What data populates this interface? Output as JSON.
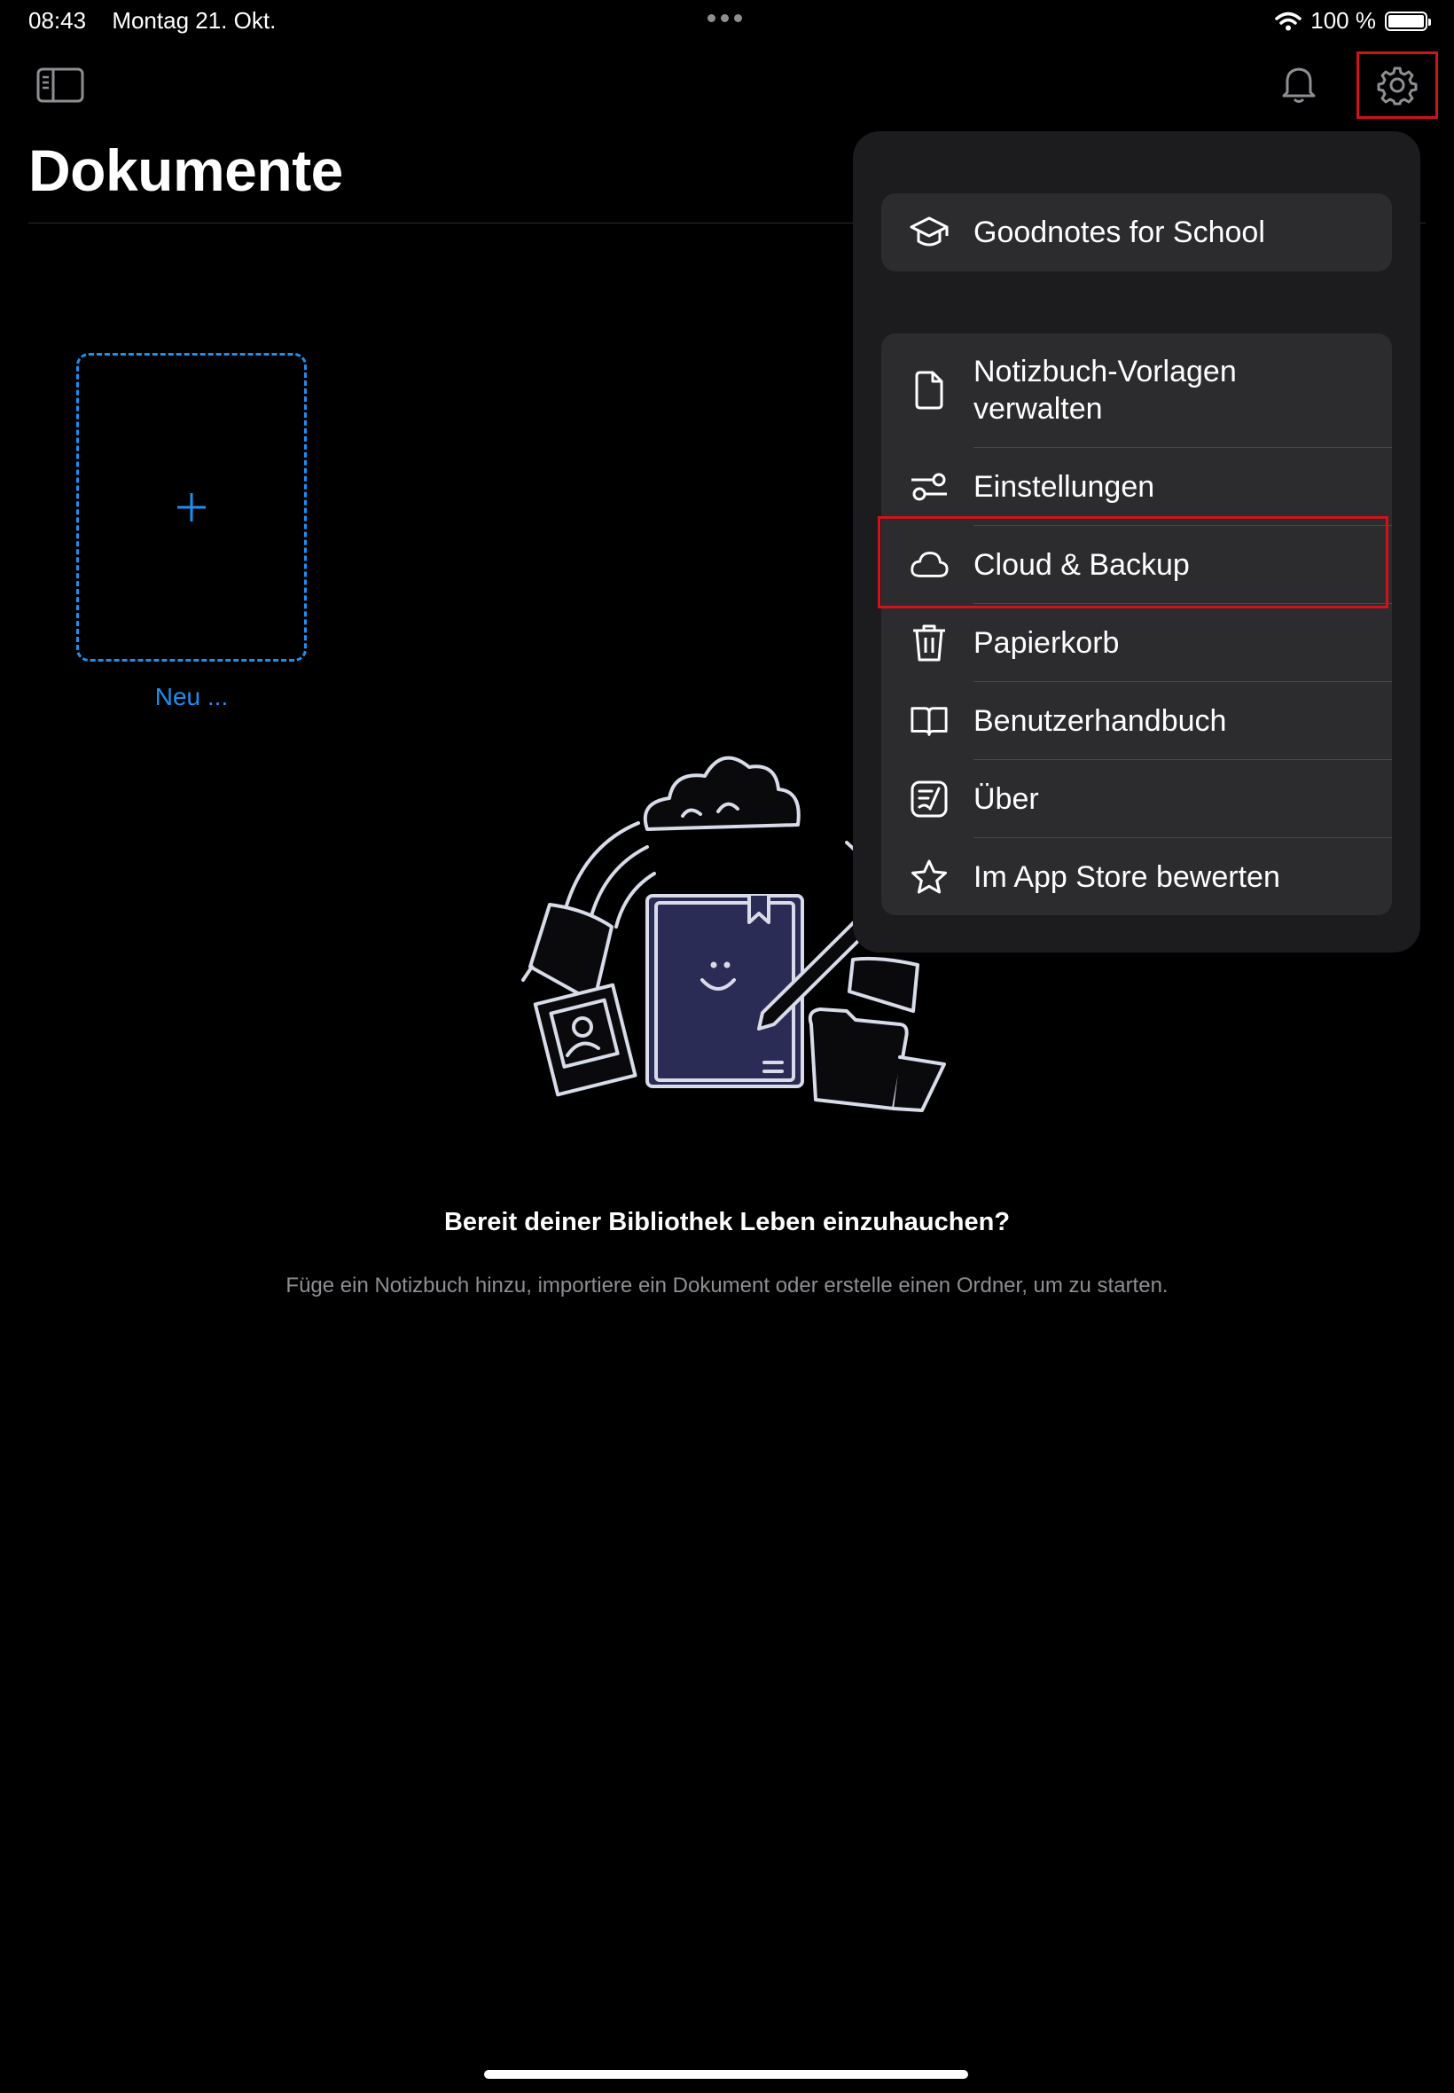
{
  "status_bar": {
    "time": "08:43",
    "date": "Montag 21. Okt.",
    "battery": "100 %",
    "icons": [
      "wifi-icon",
      "battery-icon",
      "multitasking-dots-icon"
    ]
  },
  "toolbar": {
    "sidebar_icon": "sidebar-toggle-icon",
    "notifications_icon": "bell-icon",
    "settings_icon": "gear-icon"
  },
  "page": {
    "title": "Dokumente",
    "new_label": "Neu ...",
    "empty_heading": "Bereit deiner Bibliothek Leben einzuhauchen?",
    "empty_subtext": "Füge ein Notizbuch hinzu, importiere ein Dokument oder erstelle einen Ordner, um zu starten."
  },
  "menu": {
    "school": {
      "label": "Goodnotes for School",
      "icon": "graduation-cap-icon"
    },
    "items": [
      {
        "label": "Notizbuch-Vorlagen verwalten",
        "icon": "document-icon"
      },
      {
        "label": "Einstellungen",
        "icon": "sliders-icon"
      },
      {
        "label": "Cloud & Backup",
        "icon": "cloud-icon",
        "highlighted": true
      },
      {
        "label": "Papierkorb",
        "icon": "trash-icon"
      },
      {
        "label": "Benutzerhandbuch",
        "icon": "book-icon"
      },
      {
        "label": "Über",
        "icon": "goodnotes-logo-icon"
      },
      {
        "label": "Im App Store bewerten",
        "icon": "star-icon"
      }
    ]
  },
  "colors": {
    "accent": "#1f8ef1",
    "highlight_border": "#d0121a",
    "menu_background": "#1c1c1e",
    "menu_card": "#2c2c2e",
    "background": "#000000"
  }
}
